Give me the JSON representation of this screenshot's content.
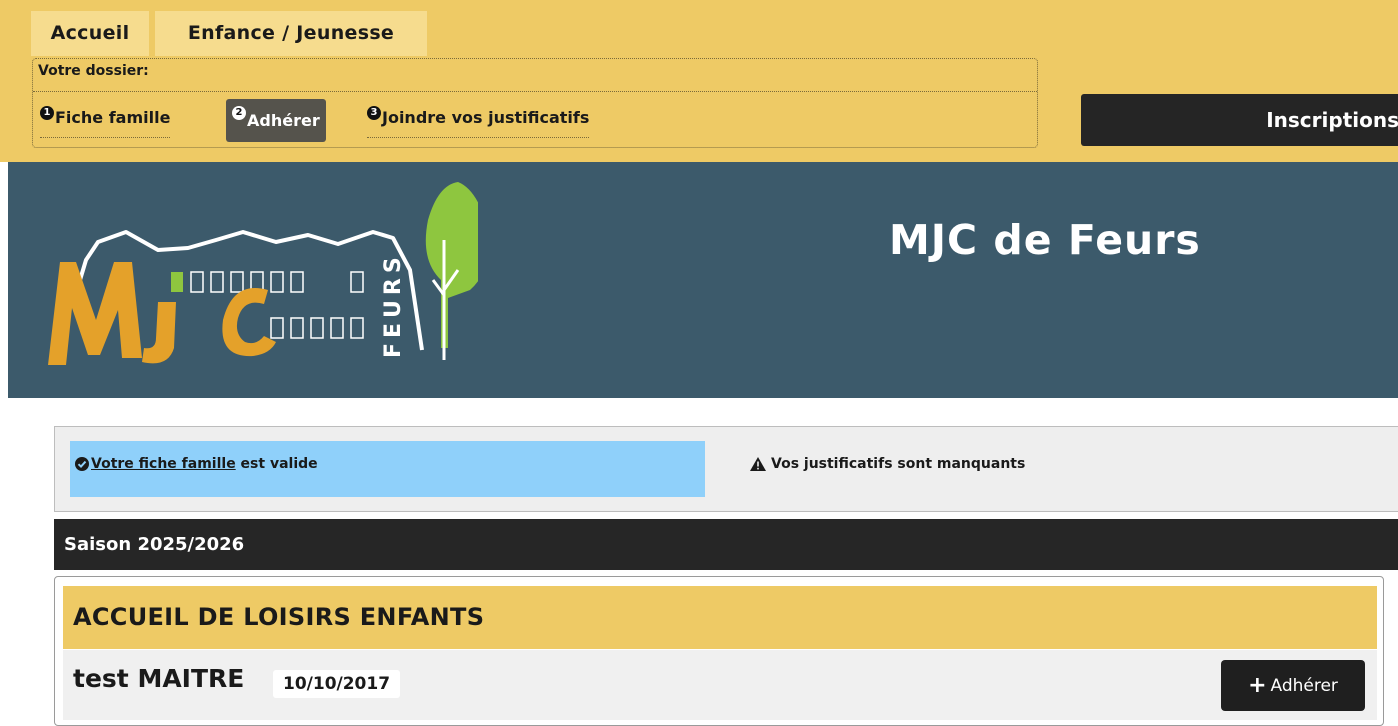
{
  "nav": {
    "tabs": [
      {
        "label": "Accueil"
      },
      {
        "label": "Enfance / Jeunesse"
      }
    ]
  },
  "dossier": {
    "label": "Votre dossier:",
    "steps": [
      {
        "num": "1",
        "label": "Fiche famille"
      },
      {
        "num": "2",
        "label": "Adhérer"
      },
      {
        "num": "3",
        "label": "Joindre vos justificatifs"
      }
    ]
  },
  "inscriptions_button": "Inscriptions",
  "banner": {
    "title": "MJC de Feurs",
    "logo_text": "FEURS"
  },
  "status": {
    "fiche_link": "Votre fiche famille",
    "fiche_suffix": " est valide",
    "warning": "Vos justificatifs sont manquants"
  },
  "season": "Saison 2025/2026",
  "activity": {
    "title": "ACCUEIL DE LOISIRS ENFANTS",
    "child_name": "test MAITRE",
    "child_birthdate": "10/10/2017",
    "adherer_label": "Adhérer"
  },
  "colors": {
    "topbar": "#eeca65",
    "banner": "#3c5a6b",
    "info_blue": "#8fd0fa",
    "logo_orange": "#e4a12a",
    "logo_green": "#8ec63f"
  }
}
